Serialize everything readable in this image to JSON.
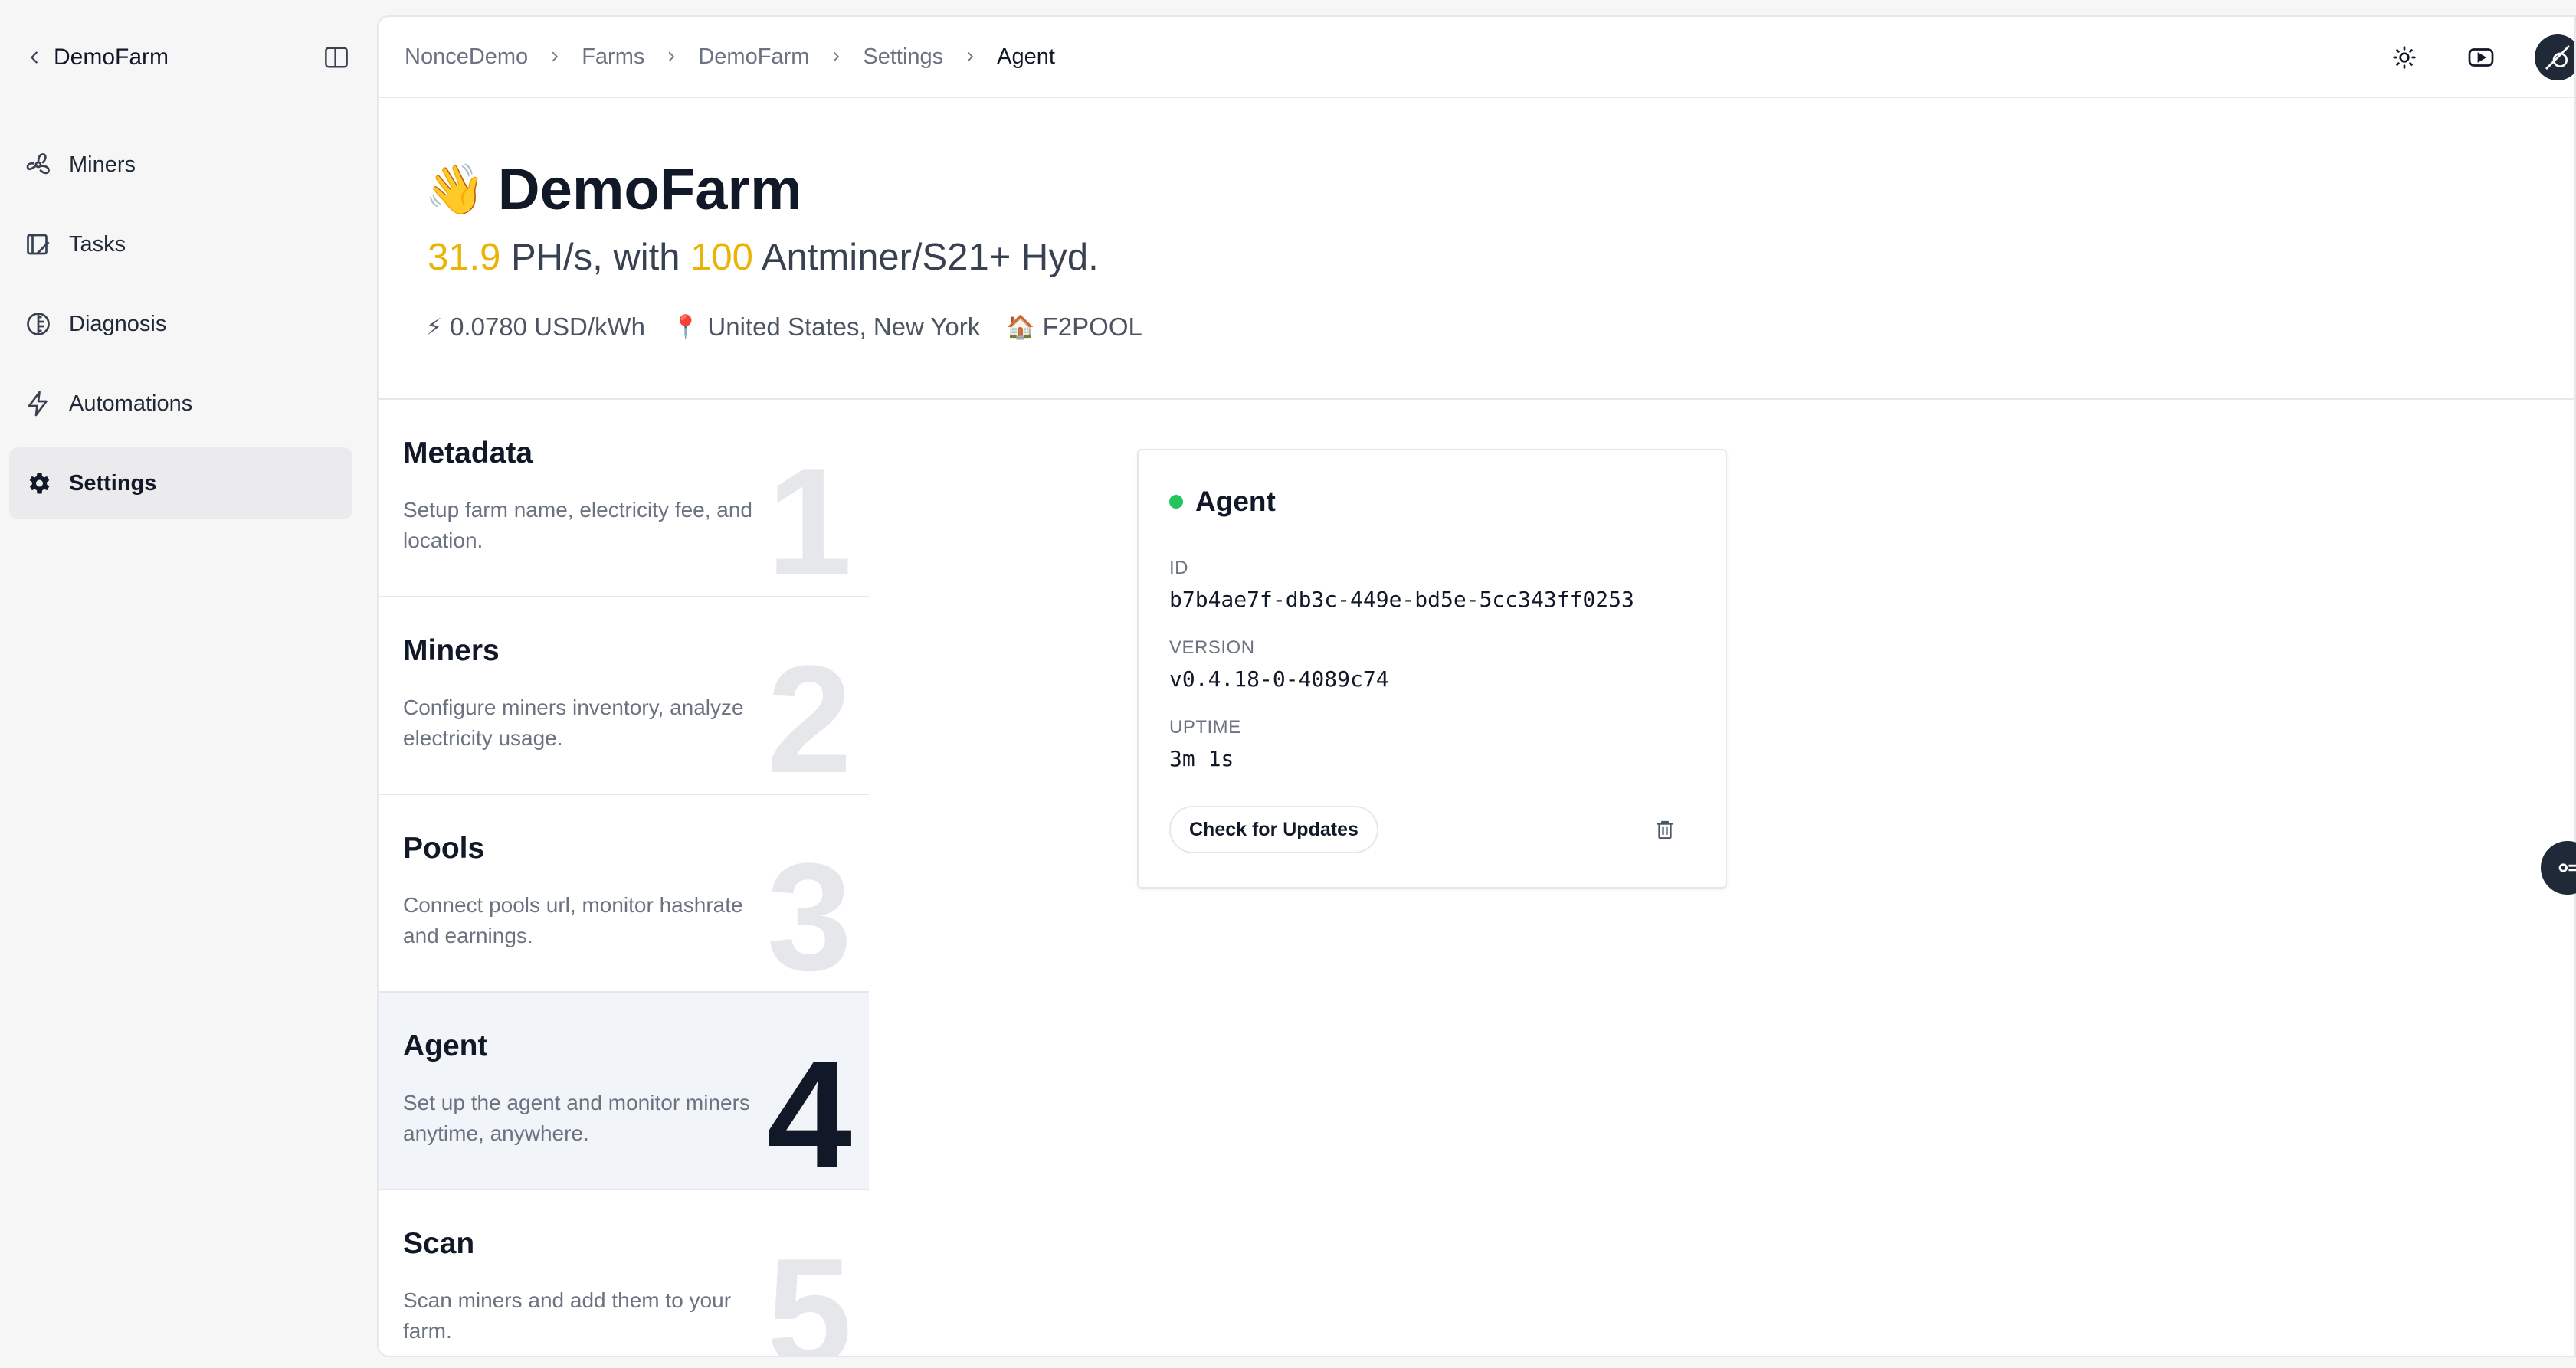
{
  "sidebar": {
    "back_icon": "chevron-left-icon",
    "title": "DemoFarm",
    "toggle_icon": "sidebar-toggle-icon",
    "items": [
      {
        "label": "Miners",
        "icon": "fan-icon",
        "active": false
      },
      {
        "label": "Tasks",
        "icon": "clipboard-icon",
        "active": false
      },
      {
        "label": "Diagnosis",
        "icon": "half-circle-icon",
        "active": false
      },
      {
        "label": "Automations",
        "icon": "lightning-icon",
        "active": false
      },
      {
        "label": "Settings",
        "icon": "gear-icon",
        "active": true
      }
    ]
  },
  "breadcrumb": [
    "NonceDemo",
    "Farms",
    "DemoFarm",
    "Settings",
    "Agent"
  ],
  "topbar": {
    "icons": [
      "sun-icon",
      "youtube-icon",
      "avatar"
    ]
  },
  "hero": {
    "emoji": "👋",
    "title": "DemoFarm",
    "hashrate": "31.9",
    "hashrate_unit_text": " PH/s, with ",
    "miner_count": "100",
    "miner_model_text": " Antminer/S21+ Hyd.",
    "price_emoji": "⚡",
    "price": "0.0780 USD/kWh",
    "location_emoji": "📍",
    "location": "United States, New York",
    "pool_emoji": "🏠",
    "pool": "F2POOL"
  },
  "steps": [
    {
      "title": "Metadata",
      "desc": "Setup farm name, electricity fee, and location.",
      "num": "1",
      "active": false
    },
    {
      "title": "Miners",
      "desc": "Configure miners inventory, analyze electricity usage.",
      "num": "2",
      "active": false
    },
    {
      "title": "Pools",
      "desc": "Connect pools url, monitor hashrate and earnings.",
      "num": "3",
      "active": false
    },
    {
      "title": "Agent",
      "desc": "Set up the agent and monitor miners anytime, anywhere.",
      "num": "4",
      "active": true
    },
    {
      "title": "Scan",
      "desc": "Scan miners and add them to your farm.",
      "num": "5",
      "active": false
    }
  ],
  "agent": {
    "title": "Agent",
    "status_color": "#22c55e",
    "id_label": "ID",
    "id_value": "b7b4ae7f-db3c-449e-bd5e-5cc343ff0253",
    "version_label": "VERSION",
    "version_value": "v0.4.18-0-4089c74",
    "uptime_label": "UPTIME",
    "uptime_value": "3m 1s",
    "update_button": "Check for Updates",
    "delete_icon": "trash-icon"
  },
  "colors": {
    "accent": "#eab308",
    "status_online": "#22c55e"
  }
}
